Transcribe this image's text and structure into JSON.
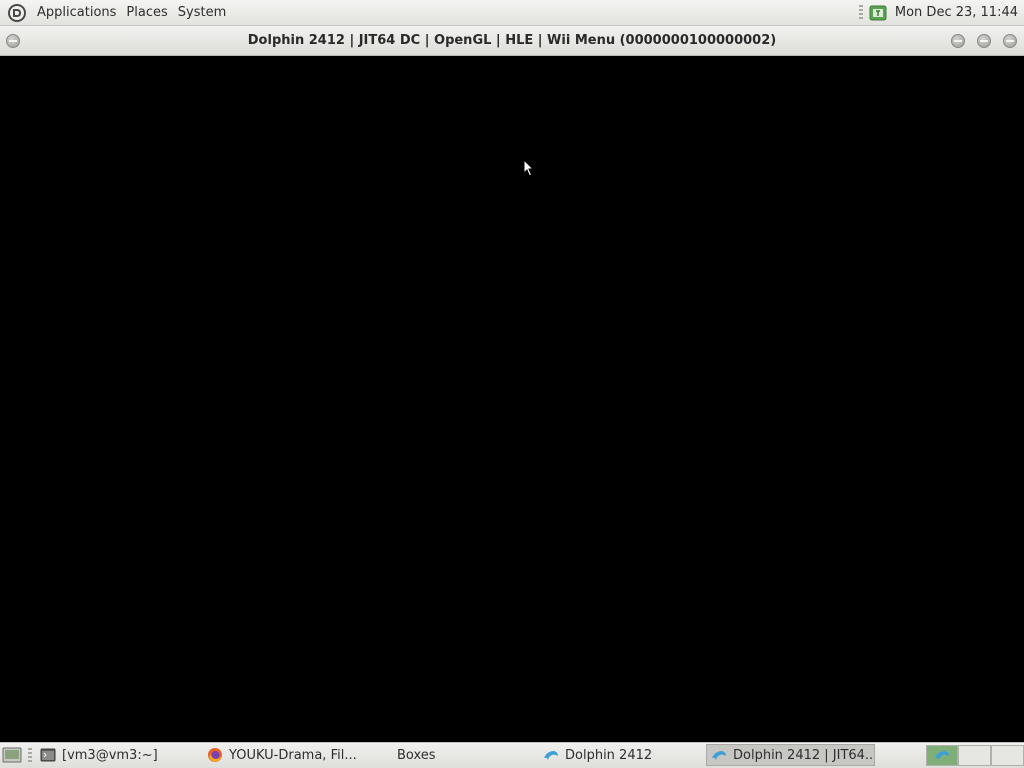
{
  "top_panel": {
    "menus": [
      "Applications",
      "Places",
      "System"
    ],
    "clock": "Mon Dec 23, 11:44",
    "tray_icon": "update-notifier-icon"
  },
  "window": {
    "title": "Dolphin 2412 | JIT64 DC | OpenGL | HLE | Wii Menu (0000000100000002)"
  },
  "taskbar": {
    "tasks": [
      {
        "label": "[vm3@vm3:~]",
        "icon": "terminal-icon"
      },
      {
        "label": "YOUKU-Drama, Fil...",
        "icon": "firefox-icon"
      },
      {
        "label": "Boxes",
        "icon": "boxes-icon"
      },
      {
        "label": "Dolphin 2412",
        "icon": "dolphin-icon"
      },
      {
        "label": "Dolphin 2412 | JIT64...",
        "icon": "dolphin-icon",
        "active": true
      }
    ]
  },
  "colors": {
    "panel": "#e8e8e4",
    "workspace_active": "#7fae78",
    "content": "#000000"
  }
}
